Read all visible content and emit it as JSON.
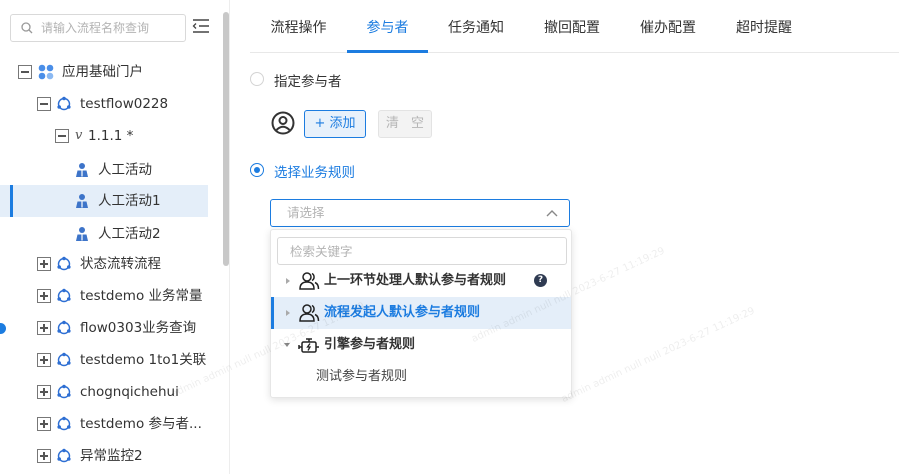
{
  "sidebar": {
    "search_placeholder": "请输入流程名称查询",
    "tree": [
      {
        "label": "应用基础门户",
        "toggle": "minus",
        "icon": "app-grid-icon"
      },
      {
        "label": "testflow0228",
        "toggle": "minus",
        "icon": "flow-cycle-icon"
      },
      {
        "label": "1.1.1 *",
        "prefix": "v",
        "toggle": "minus"
      },
      {
        "label": "人工活动",
        "icon": "person-activity-icon"
      },
      {
        "label": "人工活动1",
        "icon": "person-activity-icon",
        "selected": true
      },
      {
        "label": "人工活动2",
        "icon": "person-activity-icon"
      },
      {
        "label": "状态流转流程",
        "toggle": "plus",
        "icon": "flow-cycle-icon"
      },
      {
        "label": "testdemo  业务常量",
        "toggle": "plus",
        "icon": "flow-cycle-icon"
      },
      {
        "label": "flow0303业务查询",
        "toggle": "plus",
        "icon": "flow-cycle-icon"
      },
      {
        "label": "testdemo  1to1关联",
        "toggle": "plus",
        "icon": "flow-cycle-icon"
      },
      {
        "label": "chognqichehui",
        "toggle": "plus",
        "icon": "flow-cycle-icon"
      },
      {
        "label": "testdemo  参与者...",
        "toggle": "plus",
        "icon": "flow-cycle-icon"
      },
      {
        "label": "异常监控2",
        "toggle": "plus",
        "icon": "flow-cycle-icon"
      }
    ]
  },
  "tabs": [
    {
      "label": "流程操作"
    },
    {
      "label": "参与者",
      "active": true
    },
    {
      "label": "任务通知"
    },
    {
      "label": "撤回配置"
    },
    {
      "label": "催办配置"
    },
    {
      "label": "超时提醒"
    }
  ],
  "participants": {
    "option_specified": "指定参与者",
    "add_label": "+ 添加",
    "clear_label": "清 空",
    "option_business_rule": "选择业务规则",
    "select_placeholder": "请选择",
    "dropdown": {
      "search_placeholder": "检索关键字",
      "items": [
        {
          "label": "上一环节处理人默认参与者规则",
          "icon": "users-icon",
          "has_help": true
        },
        {
          "label": "流程发起人默认参与者规则",
          "icon": "users-icon",
          "highlight": true
        },
        {
          "label": "引擎参与者规则",
          "icon": "engine-icon",
          "expanded": true
        },
        {
          "label": "测试参与者规则",
          "leaf": true
        }
      ]
    }
  },
  "watermark_text": "admin admin null null 2023-6-27 11:19:29",
  "colors": {
    "accent": "#1c7ce0",
    "selected_bg": "#e4eef9",
    "text": "#333333"
  }
}
